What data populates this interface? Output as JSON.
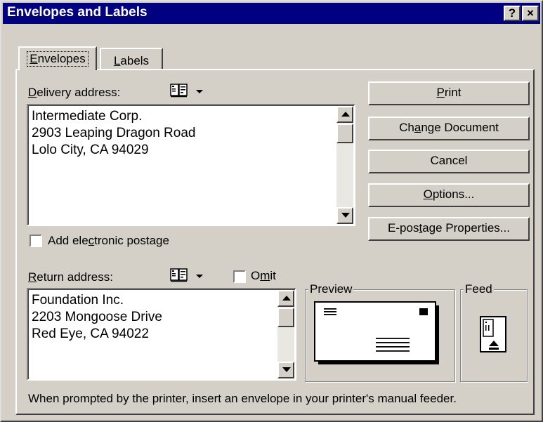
{
  "window": {
    "title": "Envelopes and Labels",
    "help_button": "?",
    "close_button": "×"
  },
  "tabs": [
    {
      "label_pre": "",
      "label_key": "E",
      "label_post": "nvelopes",
      "active": true
    },
    {
      "label_pre": "",
      "label_key": "L",
      "label_post": "abels",
      "active": false
    }
  ],
  "delivery": {
    "label_key": "D",
    "label_post": "elivery address:",
    "address": "Intermediate Corp.\n2903 Leaping Dragon Road\nLolo City, CA 94029"
  },
  "postage": {
    "pre": "Add ele",
    "key": "c",
    "post": "tronic postage",
    "checked": false
  },
  "return": {
    "label_key": "R",
    "label_post": "eturn address:",
    "address": "Foundation Inc.\n2203 Mongoose Drive\nRed Eye, CA 94022",
    "omit_pre": "O",
    "omit_key": "m",
    "omit_post": "it",
    "omit_checked": false
  },
  "buttons": {
    "print": {
      "pre": "",
      "key": "P",
      "post": "rint"
    },
    "change": {
      "pre": "Ch",
      "key": "a",
      "post": "nge Document"
    },
    "cancel": {
      "pre": "Cancel",
      "key": "",
      "post": ""
    },
    "options": {
      "pre": "",
      "key": "O",
      "post": "ptions..."
    },
    "epostage": {
      "pre": "E-pos",
      "key": "t",
      "post": "age Properties..."
    }
  },
  "preview": {
    "title": "Preview"
  },
  "feed": {
    "title": "Feed"
  },
  "footer": {
    "message": "When prompted by the printer, insert an envelope in your printer's manual feeder."
  },
  "icons": {
    "address_book": "address-book-icon",
    "dropdown": "chevron-down-icon"
  },
  "colors": {
    "titlebar": "#000080",
    "face": "#d4d0c8"
  }
}
